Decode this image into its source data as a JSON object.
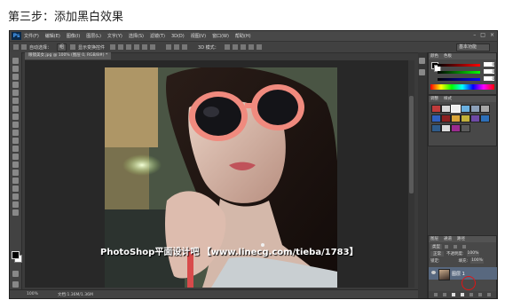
{
  "page": {
    "heading": "第三步：添加黑白效果"
  },
  "app": {
    "logo": "Ps"
  },
  "menubar": {
    "items": [
      "文件(F)",
      "编辑(E)",
      "图像(I)",
      "图层(L)",
      "文字(Y)",
      "选择(S)",
      "滤镜(T)",
      "3D(D)",
      "视图(V)",
      "窗口(W)",
      "帮助(H)"
    ]
  },
  "window_controls": [
    "–",
    "□",
    "×"
  ],
  "options": {
    "auto_select_label": "自动选择：",
    "auto_select_value": "组",
    "show_transform": "显示变换控件",
    "mode_label": "3D 模式：",
    "workspace": "基本功能"
  },
  "document": {
    "tab_title": "眼镜美女.jpg @ 100% (图层 0, RGB/8#) *"
  },
  "status": {
    "zoom": "100%",
    "doc_size": "文档:1.36M/1.36M"
  },
  "panels": {
    "color_tab": "颜色",
    "swatches_tab": "色板",
    "adjust_tab": "调整",
    "styles_tab": "样式",
    "layers_tab": "图层",
    "channels_tab": "通道",
    "paths_tab": "路径",
    "kind_label": "类型",
    "blend_mode": "正常",
    "opacity_label": "不透明度:",
    "opacity_value": "100%",
    "lock_label": "锁定:",
    "fill_label": "填充:",
    "fill_value": "100%",
    "color_values": {
      "r": "0",
      "g": "0",
      "b": "0"
    },
    "layer_name": "图层 1"
  },
  "watermark": "PhotoShop平面设计吧 【www.linecg.com/tieba/1783】",
  "colors": {
    "ui_bg": "#3b3b3b",
    "panel_bg": "#484848",
    "highlight": "#e01515",
    "layer_selected": "#58687f"
  }
}
